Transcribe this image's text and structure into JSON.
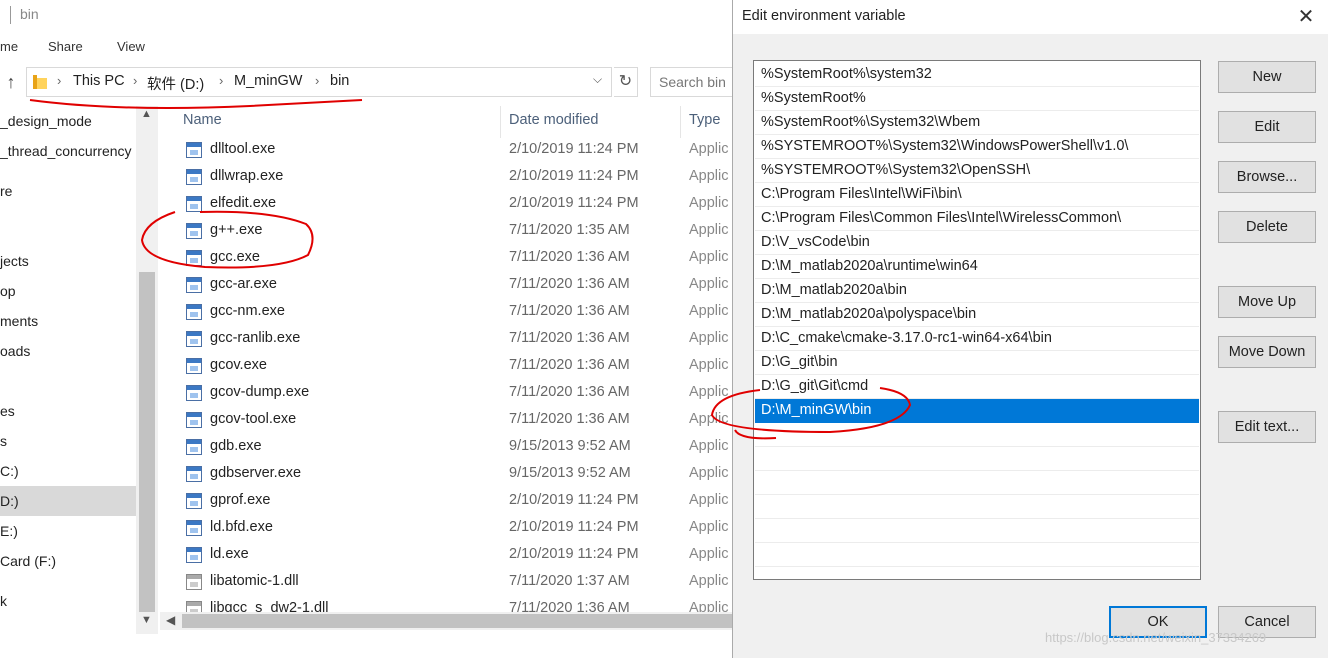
{
  "explorer": {
    "title": "bin",
    "ribbon": [
      "me",
      "Share",
      "View"
    ],
    "breadcrumb": [
      "This PC",
      "软件 (D:)",
      "M_minGW",
      "bin"
    ],
    "search_placeholder": "Search bin",
    "nav_items": [
      "_design_mode",
      "_thread_concurrency",
      "re",
      "jects",
      "op",
      "ments",
      "oads",
      "es",
      "s",
      "C:)",
      "D:)",
      "E:)",
      "Card (F:)",
      "k"
    ],
    "columns": {
      "name": "Name",
      "date": "Date modified",
      "type": "Type"
    },
    "files": [
      {
        "name": "dlltool.exe",
        "date": "2/10/2019 11:24 PM",
        "type": "Applic"
      },
      {
        "name": "dllwrap.exe",
        "date": "2/10/2019 11:24 PM",
        "type": "Applic"
      },
      {
        "name": "elfedit.exe",
        "date": "2/10/2019 11:24 PM",
        "type": "Applic"
      },
      {
        "name": "g++.exe",
        "date": "7/11/2020 1:35 AM",
        "type": "Applic"
      },
      {
        "name": "gcc.exe",
        "date": "7/11/2020 1:36 AM",
        "type": "Applic"
      },
      {
        "name": "gcc-ar.exe",
        "date": "7/11/2020 1:36 AM",
        "type": "Applic"
      },
      {
        "name": "gcc-nm.exe",
        "date": "7/11/2020 1:36 AM",
        "type": "Applic"
      },
      {
        "name": "gcc-ranlib.exe",
        "date": "7/11/2020 1:36 AM",
        "type": "Applic"
      },
      {
        "name": "gcov.exe",
        "date": "7/11/2020 1:36 AM",
        "type": "Applic"
      },
      {
        "name": "gcov-dump.exe",
        "date": "7/11/2020 1:36 AM",
        "type": "Applic"
      },
      {
        "name": "gcov-tool.exe",
        "date": "7/11/2020 1:36 AM",
        "type": "Applic"
      },
      {
        "name": "gdb.exe",
        "date": "9/15/2013 9:52 AM",
        "type": "Applic"
      },
      {
        "name": "gdbserver.exe",
        "date": "9/15/2013 9:52 AM",
        "type": "Applic"
      },
      {
        "name": "gprof.exe",
        "date": "2/10/2019 11:24 PM",
        "type": "Applic"
      },
      {
        "name": "ld.bfd.exe",
        "date": "2/10/2019 11:24 PM",
        "type": "Applic"
      },
      {
        "name": "ld.exe",
        "date": "2/10/2019 11:24 PM",
        "type": "Applic"
      },
      {
        "name": "libatomic-1.dll",
        "date": "7/11/2020 1:37 AM",
        "type": "Applic"
      },
      {
        "name": "libgcc_s_dw2-1.dll",
        "date": "7/11/2020 1:36 AM",
        "type": "Applic"
      }
    ]
  },
  "dialog": {
    "title": "Edit environment variable",
    "close_glyph": "✕",
    "paths": [
      "%SystemRoot%\\system32",
      "%SystemRoot%",
      "%SystemRoot%\\System32\\Wbem",
      "%SYSTEMROOT%\\System32\\WindowsPowerShell\\v1.0\\",
      "%SYSTEMROOT%\\System32\\OpenSSH\\",
      "C:\\Program Files\\Intel\\WiFi\\bin\\",
      "C:\\Program Files\\Common Files\\Intel\\WirelessCommon\\",
      "D:\\V_vsCode\\bin",
      "D:\\M_matlab2020a\\runtime\\win64",
      "D:\\M_matlab2020a\\bin",
      "D:\\M_matlab2020a\\polyspace\\bin",
      "D:\\C_cmake\\cmake-3.17.0-rc1-win64-x64\\bin",
      "D:\\G_git\\bin",
      "D:\\G_git\\Git\\cmd",
      "D:\\M_minGW\\bin"
    ],
    "selected_index": 14,
    "buttons": {
      "new": "New",
      "edit": "Edit",
      "browse": "Browse...",
      "delete": "Delete",
      "move_up": "Move Up",
      "move_down": "Move Down",
      "edit_text": "Edit text...",
      "ok": "OK",
      "cancel": "Cancel"
    },
    "watermark": "https://blog.csdn.net/weixin_37334269"
  },
  "colors": {
    "selection": "#0078d7",
    "annotation": "#e00000"
  }
}
